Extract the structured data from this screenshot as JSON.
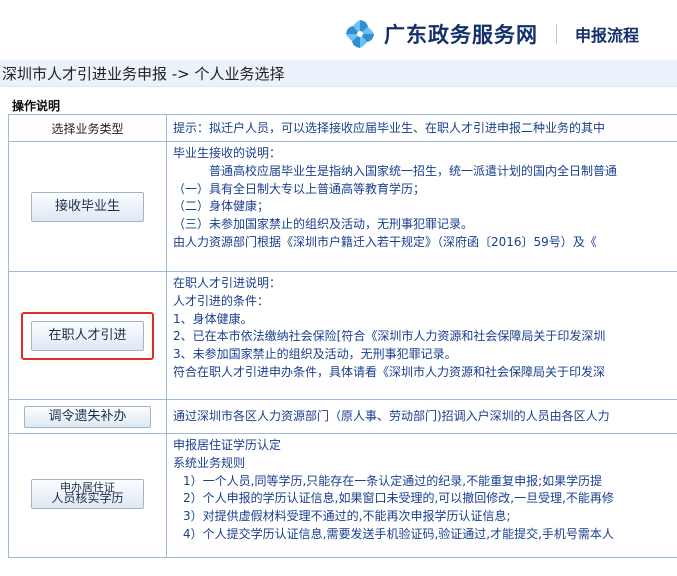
{
  "header": {
    "site_name": "广东政务服务网",
    "link": "申报流程",
    "logo_icon": "pinwheel-logo-icon",
    "brand_color": "#14306b",
    "logo_color": "#2e8fd6"
  },
  "breadcrumb": "深圳市人才引进业务申报 -> 个人业务选择",
  "section_title": "操作说明",
  "table": {
    "header": {
      "left": "选择业务类型",
      "right": "提示：拟迁户人员，可以选择接收应届毕业生、在职人才引进申报二种业务的其中"
    },
    "rows": [
      {
        "button": "接收毕业生",
        "lines": [
          "毕业生接收的说明：",
          "普通高校应届毕业生是指纳入国家统一招生，统一派遣计划的国内全日制普通",
          "（一）具有全日制大专以上普通高等教育学历；",
          "（二）身体健康；",
          "（三）未参加国家禁止的组织及活动，无刑事犯罪记录。",
          "由人力资源部门根据《深圳市户籍迁入若干规定》（深府函〔2016〕59号）及《"
        ]
      },
      {
        "button": "在职人才引进",
        "lines": [
          "在职人才引进说明：",
          "人才引进的条件：",
          "1、身体健康。",
          "2、已在本市依法缴纳社会保险[符合《深圳市人力资源和社会保障局关于印发深圳",
          "3、未参加国家禁止的组织及活动，无刑事犯罪记录。",
          "符合在职人才引进申办条件，具体请看《深圳市人力资源和社会保障局关于印发深"
        ]
      },
      {
        "button": "调令遗失补办",
        "lines": [
          "通过深圳市各区人力资源部门（原人事、劳动部门)招调入户深圳的人员由各区人力"
        ]
      },
      {
        "button_line1": "申办居住证",
        "button_line2": "人员核实学历",
        "lines": [
          "申报居住证学历认定",
          "系统业务规则",
          "1）一个人员,同等学历,只能存在一条认定通过的纪录,不能重复申报;如果学历提",
          "2）个人申报的学历认证信息,如果窗口未受理的,可以撤回修改,一旦受理,不能再修",
          "3）对提供虚假材料受理不通过的,不能再次申报学历认证信息;",
          "4）个人提交学历认证信息,需要发送手机验证码,验证通过,才能提交,手机号需本人"
        ]
      }
    ]
  },
  "highlight_color": "#e02b2b",
  "text_color": "#1a3f8f",
  "border_color": "#9dbad9"
}
